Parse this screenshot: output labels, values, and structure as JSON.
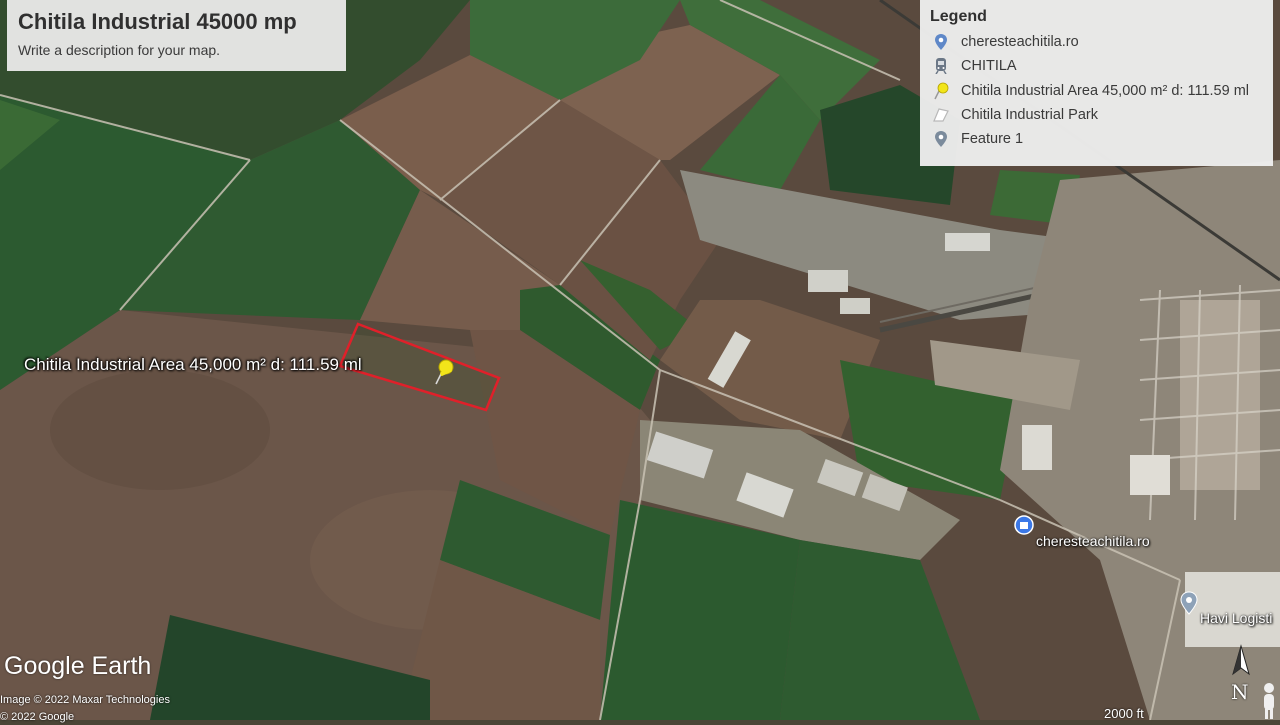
{
  "title": "Chitila Industrial 45000 mp",
  "description": "Write a description for your map.",
  "legend": {
    "heading": "Legend",
    "items": [
      {
        "label": "cheresteachitila.ro",
        "icon": "map-pin-icon"
      },
      {
        "label": "CHITILA",
        "icon": "train-icon"
      },
      {
        "label": "Chitila Industrial Area 45,000 m² d: 111.59 ml",
        "icon": "yellow-pushpin-icon"
      },
      {
        "label": "Chitila Industrial Park",
        "icon": "polygon-icon"
      },
      {
        "label": "Feature 1",
        "icon": "map-pin-icon"
      }
    ]
  },
  "map": {
    "area_label": "Chitila Industrial Area 45,000 m² d: 111.59 ml",
    "poi_cherestea": "cheresteachitila.ro",
    "poi_havi": "Havi Logisti",
    "scale": "2000 ft",
    "compass_letter": "N"
  },
  "branding": {
    "logo": "Google Earth",
    "credit": "Image © 2022 Maxar Technologies",
    "credit2": "© 2022 Google"
  },
  "colors": {
    "polygon_outline": "#e0202a",
    "pushpin": "#f2e51a",
    "poi_marker": "#3b78e7"
  }
}
